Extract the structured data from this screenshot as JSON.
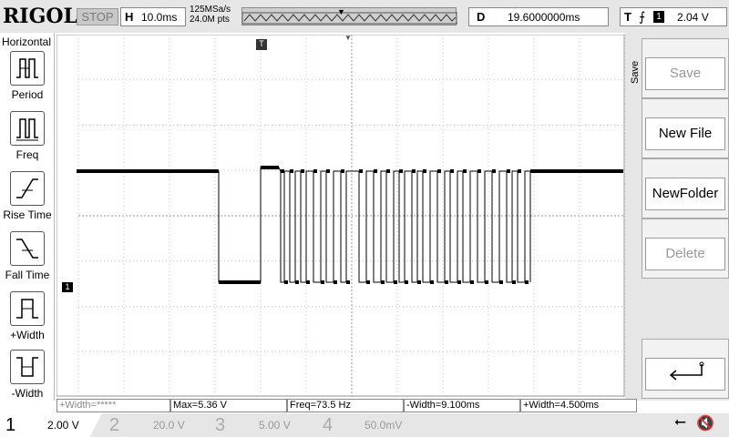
{
  "top": {
    "brand": "RIGOL",
    "run_state": "STOP",
    "horizontal_key": "H",
    "timebase": "10.0ms",
    "sample_rate": "125MSa/s",
    "memory_depth": "24.0M pts",
    "delay_key": "D",
    "delay": "19.6000000ms",
    "trigger_key": "T",
    "trigger_edge": "⨍",
    "trigger_source": "1",
    "trigger_level": "2.04 V"
  },
  "left": {
    "title": "Horizontal",
    "items": [
      {
        "label": "Period"
      },
      {
        "label": "Freq"
      },
      {
        "label": "Rise Time"
      },
      {
        "label": "Fall Time"
      },
      {
        "label": "+Width"
      },
      {
        "label": "-Width"
      }
    ]
  },
  "right": {
    "title": "Save",
    "items": [
      {
        "label": "Save",
        "enabled": false
      },
      {
        "label": "New File",
        "enabled": true
      },
      {
        "label": "NewFolder",
        "enabled": true
      },
      {
        "label": "Delete",
        "enabled": false
      },
      {
        "label": "↵",
        "enabled": true
      }
    ]
  },
  "measurements": [
    "+Width=*****",
    "Max=5.36 V",
    "Freq=73.5 Hz",
    "-Width=9.100ms",
    "+Width=4.500ms"
  ],
  "markers": {
    "trigger_top": "T",
    "channel_marker": "1",
    "trigger_level_marker": "T"
  },
  "channels": [
    {
      "num": "1",
      "scale": "2.00 V",
      "active": true
    },
    {
      "num": "2",
      "scale": "20.0 V",
      "active": false
    },
    {
      "num": "3",
      "scale": "5.00 V",
      "active": false
    },
    {
      "num": "4",
      "scale": "50.0mV",
      "active": false
    }
  ],
  "status_icons": [
    "usb-icon",
    "speaker-muted-icon"
  ],
  "colors": {
    "trace": "#000000",
    "grid": "#b4b4b4",
    "panel": "#e6e6e6"
  }
}
